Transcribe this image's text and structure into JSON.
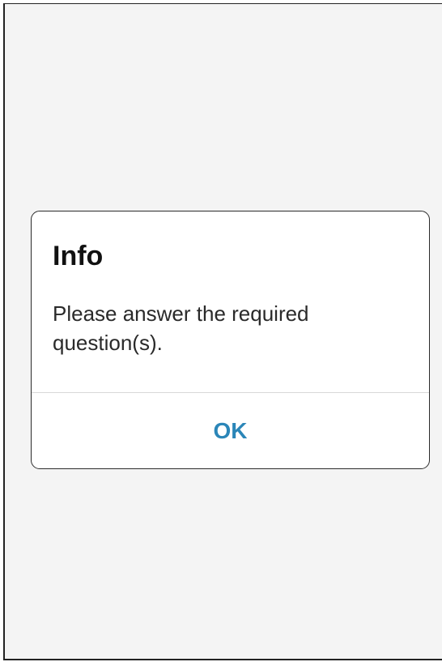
{
  "dialog": {
    "title": "Info",
    "message": "Please answer the required question(s).",
    "ok_label": "OK"
  },
  "colors": {
    "background": "#f4f4f4",
    "dialog_background": "#ffffff",
    "accent": "#2b86b8",
    "title_text": "#111111",
    "message_text": "#2a2a2a"
  }
}
